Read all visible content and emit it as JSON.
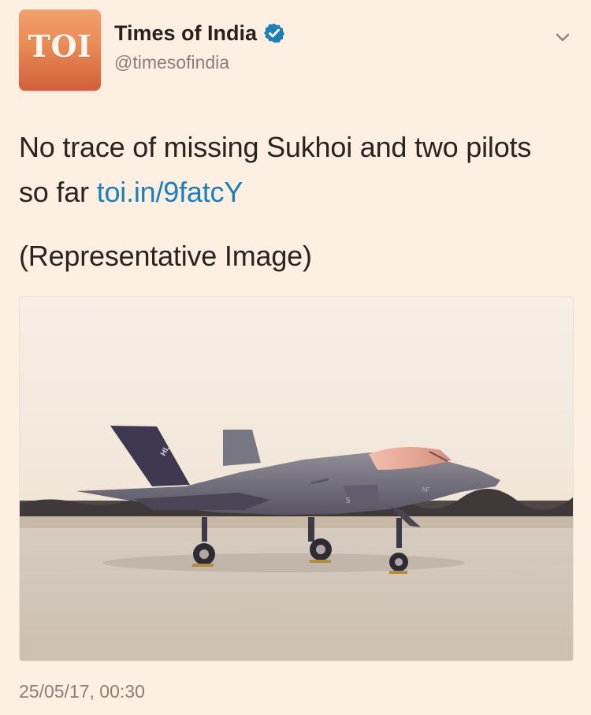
{
  "tweet": {
    "avatar": {
      "brand_text": "TOI",
      "colors": {
        "top": "#f2a06e",
        "bottom": "#cf5f3b"
      }
    },
    "author": {
      "display_name": "Times of India",
      "handle": "@timesofindia",
      "verified": true,
      "verified_color": "#1d7fb7"
    },
    "menu_icon": "chevron-down-icon",
    "text": {
      "main": "No trace of missing Sukhoi and two pilots so far",
      "link": "toi.in/9fatcY",
      "note": "(Representative Image)"
    },
    "timestamp": "25/05/17, 00:30",
    "colors": {
      "background": "#fdefe1",
      "link": "#1d7fb7",
      "muted": "#8b7f79"
    }
  }
}
